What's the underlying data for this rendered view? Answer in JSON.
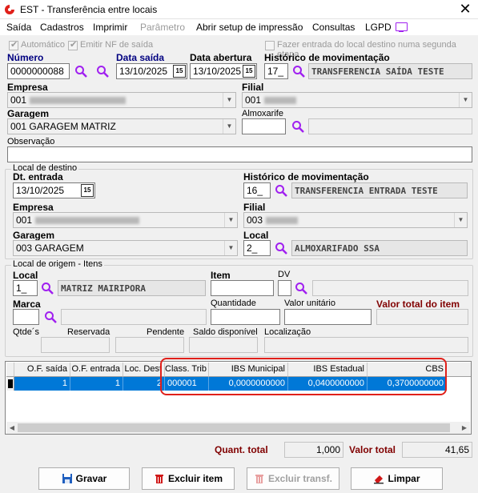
{
  "window": {
    "title": "EST - Transferência entre locais",
    "close": "✕"
  },
  "menu": [
    "Saída",
    "Cadastros",
    "Imprimir",
    "Parâmetro",
    "Abrir setup de impressão",
    "Consultas",
    "LGPD"
  ],
  "options": {
    "automatico": "Automático",
    "emitir_nf": "Emitir NF de saída",
    "fazer_entrada": "Fazer entrada do local destino numa segunda etapa"
  },
  "header": {
    "numero_label": "Número",
    "numero": "0000000088",
    "data_saida_label": "Data saída",
    "data_saida": "13/10/2025",
    "data_abertura_label": "Data abertura",
    "data_abertura": "13/10/2025",
    "historico_label": "Histórico de movimentação",
    "historico_code": "17_",
    "historico_desc": "TRANSFERENCIA SAÍDA TESTE",
    "empresa_label": "Empresa",
    "empresa_code": "001",
    "filial_label": "Filial",
    "filial_code": "001",
    "garagem_label": "Garagem",
    "garagem": "001 GARAGEM MATRIZ",
    "almoxarife_label": "Almoxarife",
    "observacao_label": "Observação",
    "cal_icon": "15"
  },
  "destino": {
    "group_label": "Local de destino",
    "dt_entrada_label": "Dt. entrada",
    "dt_entrada": "13/10/2025",
    "historico_label": "Histórico de movimentação",
    "historico_code": "16_",
    "historico_desc": "TRANSFERENCIA ENTRADA TESTE",
    "empresa_label": "Empresa",
    "empresa_code": "001",
    "filial_label": "Filial",
    "filial_code": "003",
    "garagem_label": "Garagem",
    "garagem": "003 GARAGEM",
    "local_label": "Local",
    "local_code": "2_",
    "local_desc": "ALMOXARIFADO SSA"
  },
  "origem": {
    "group_label": "Local de origem - Itens",
    "local_label": "Local",
    "local_code": "1_",
    "local_desc": "MATRIZ MAIRIPORA",
    "item_label": "Item",
    "dv_label": "DV",
    "marca_label": "Marca",
    "quantidade_label": "Quantidade",
    "valor_unitario_label": "Valor unitário",
    "valor_total_label": "Valor total do item",
    "qtdes_label": "Qtde´s",
    "reservada_label": "Reservada",
    "pendente_label": "Pendente",
    "saldo_label": "Saldo disponível",
    "localizacao_label": "Localização"
  },
  "grid": {
    "columns": [
      "O.F. saída",
      "O.F. entrada",
      "Loc. Dest",
      "Class. Trib",
      "IBS Municipal",
      "IBS Estadual",
      "CBS"
    ],
    "rows": [
      [
        "1",
        "1",
        "2",
        "000001",
        "0,0000000000",
        "0,0400000000",
        "0,3700000000"
      ]
    ]
  },
  "totals": {
    "quant_label": "Quant. total",
    "quant": "1,000",
    "valor_label": "Valor total",
    "valor": "41,65"
  },
  "buttons": {
    "gravar": "Gravar",
    "excluir_item": "Excluir item",
    "excluir_transf": "Excluir transf.",
    "limpar": "Limpar"
  },
  "colors": {
    "accent_blue": "#000080",
    "maroon": "#800000",
    "selection": "#0078d7",
    "highlight": "#e0201a",
    "search_icon": "#a020f0"
  }
}
